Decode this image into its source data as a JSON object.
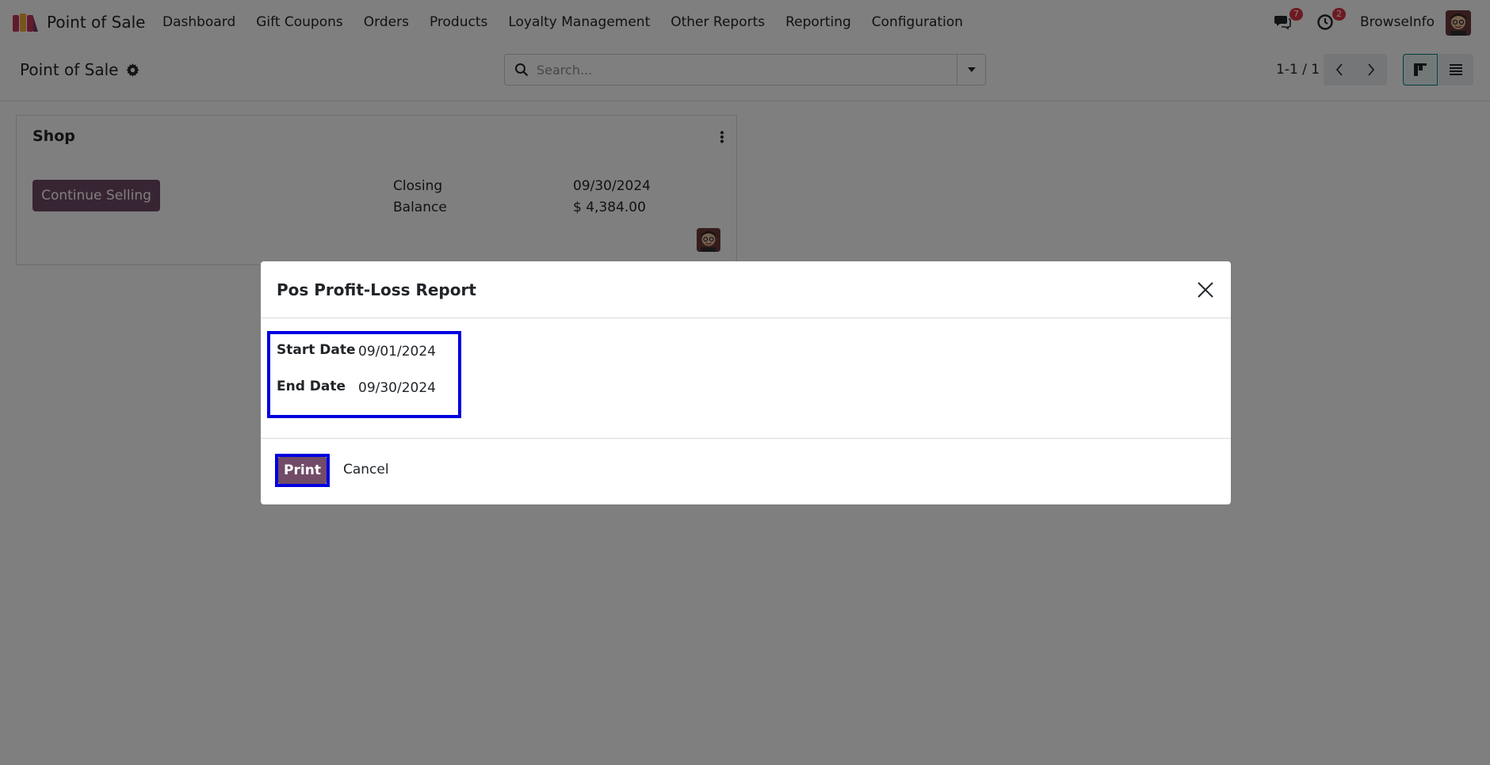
{
  "navbar": {
    "app_name": "Point of Sale",
    "menu": [
      "Dashboard",
      "Gift Coupons",
      "Orders",
      "Products",
      "Loyalty Management",
      "Other Reports",
      "Reporting",
      "Configuration"
    ],
    "chat_count": "7",
    "activity_count": "2",
    "company": "BrowseInfo"
  },
  "control_panel": {
    "breadcrumb": "Point of Sale",
    "search_placeholder": "Search...",
    "pager": "1-1 / 1"
  },
  "card": {
    "title": "Shop",
    "button": "Continue Selling",
    "closing_label": "Closing",
    "closing_value": "09/30/2024",
    "balance_label": "Balance",
    "balance_value": "$ 4,384.00"
  },
  "modal": {
    "title": "Pos Profit-Loss Report",
    "start_label": "Start Date",
    "start_value": "09/01/2024",
    "end_label": "End Date",
    "end_value": "09/30/2024",
    "print_label": "Print",
    "cancel_label": "Cancel"
  },
  "colors": {
    "brand": "#714b67",
    "highlight": "#0000e0",
    "badge": "#dc3545"
  },
  "icons": [
    "app-logo-icon",
    "gear-icon",
    "search-icon",
    "caret-down-icon",
    "chevron-left-icon",
    "chevron-right-icon",
    "kanban-view-icon",
    "list-view-icon",
    "chat-icon",
    "clock-icon",
    "kebab-menu-icon",
    "close-icon"
  ]
}
